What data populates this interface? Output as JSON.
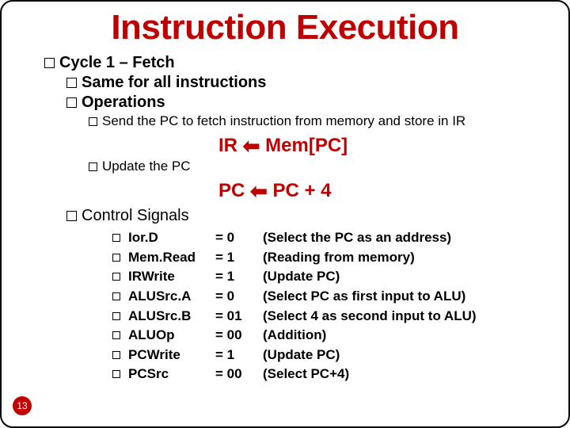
{
  "title": "Instruction Execution",
  "lv1": "Cycle 1 – Fetch",
  "lv2a": "Same for all instructions",
  "lv2b": "Operations",
  "op_send": "Send the PC to fetch instruction from memory and store in IR",
  "formula1": {
    "lhs": "IR",
    "rhs": "Mem[PC]"
  },
  "op_update": "Update the PC",
  "formula2": {
    "lhs": "PC",
    "rhs": "PC + 4"
  },
  "lv2c": "Control Signals",
  "signals": [
    {
      "name": "Ior.D",
      "val": "= 0",
      "desc": "(Select the PC as an address)"
    },
    {
      "name": "Mem.Read",
      "val": "= 1",
      "desc": "(Reading from memory)"
    },
    {
      "name": "IRWrite",
      "val": "= 1",
      "desc": "(Update PC)"
    },
    {
      "name": "ALUSrc.A",
      "val": "= 0",
      "desc": "(Select PC as first input to ALU)"
    },
    {
      "name": "ALUSrc.B",
      "val": "= 01",
      "desc": "(Select 4 as second input to ALU)"
    },
    {
      "name": "ALUOp",
      "val": "= 00",
      "desc": "(Addition)"
    },
    {
      "name": "PCWrite",
      "val": "= 1",
      "desc": "(Update PC)"
    },
    {
      "name": "PCSrc",
      "val": "= 00",
      "desc": "(Select PC+4)"
    }
  ],
  "page_number": "13",
  "arrow_glyph": "⬅"
}
